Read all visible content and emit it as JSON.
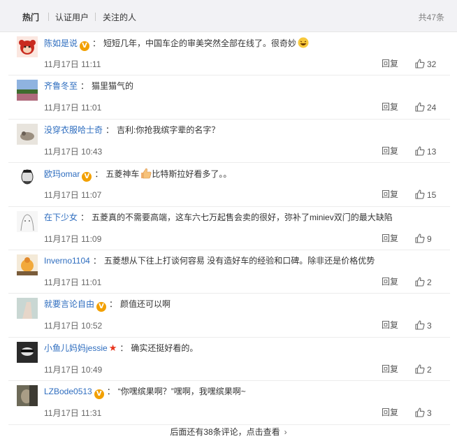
{
  "tabs": [
    {
      "label": "热门",
      "active": true
    },
    {
      "label": "认证用户",
      "active": false
    },
    {
      "label": "关注的人",
      "active": false
    }
  ],
  "total": "共47条",
  "comments": [
    {
      "user": "陈如是说",
      "badge": "V",
      "text": "短短几年，中国车企的审美突然全部在线了。很奇妙",
      "emoji": "laugh-emoji",
      "time": "11月17日 11:11",
      "reply": "回复",
      "likes": "32"
    },
    {
      "user": "齐鲁冬至",
      "badge": "",
      "text": "猫里猫气的",
      "emoji": "",
      "time": "11月17日 11:01",
      "reply": "回复",
      "likes": "24"
    },
    {
      "user": "没穿衣服哈士奇",
      "badge": "",
      "text": "吉利:你抢我缤字辈的名字？",
      "emoji": "",
      "time": "11月17日 10:43",
      "reply": "回复",
      "likes": "13"
    },
    {
      "user": "欧玛omar",
      "badge": "V",
      "text": "五菱神车",
      "emoji": "thumbs-up-emoji",
      "text2": "比特斯拉好看多了。。",
      "time": "11月17日 11:07",
      "reply": "回复",
      "likes": "15"
    },
    {
      "user": "在下少女",
      "badge": "",
      "text": "五菱真的不需要高端，这车六七万起售会卖的很好，弥补了miniev双门的最大缺陷",
      "emoji": "",
      "time": "11月17日 11:09",
      "reply": "回复",
      "likes": "9"
    },
    {
      "user": "Inverno1104",
      "badge": "",
      "text": "五菱想从下往上打谈何容易 没有造好车的经验和口碑。除非还是价格优势",
      "emoji": "",
      "time": "11月17日 11:01",
      "reply": "回复",
      "likes": "2"
    },
    {
      "user": "就要言论自由",
      "badge": "V",
      "text": "颜值还可以啊",
      "emoji": "",
      "time": "11月17日 10:52",
      "reply": "回复",
      "likes": "3"
    },
    {
      "user": "小鱼儿妈妈jessie",
      "badge": "star",
      "text": "确实还挺好看的。",
      "emoji": "",
      "time": "11月17日 10:49",
      "reply": "回复",
      "likes": "2"
    },
    {
      "user": "LZBode0513",
      "badge": "V",
      "text": "“你嘿缤果啊？”嘿啊，我嘿缤果啊~",
      "emoji": "",
      "time": "11月17日 11:31",
      "reply": "回复",
      "likes": "3"
    }
  ],
  "more_link": "后面还有38条评论，点击查看",
  "colors": {
    "link": "#2e6dbf",
    "vip": "#f2a000",
    "star": "#e8341c",
    "tabbar": "#f2f2f5"
  }
}
